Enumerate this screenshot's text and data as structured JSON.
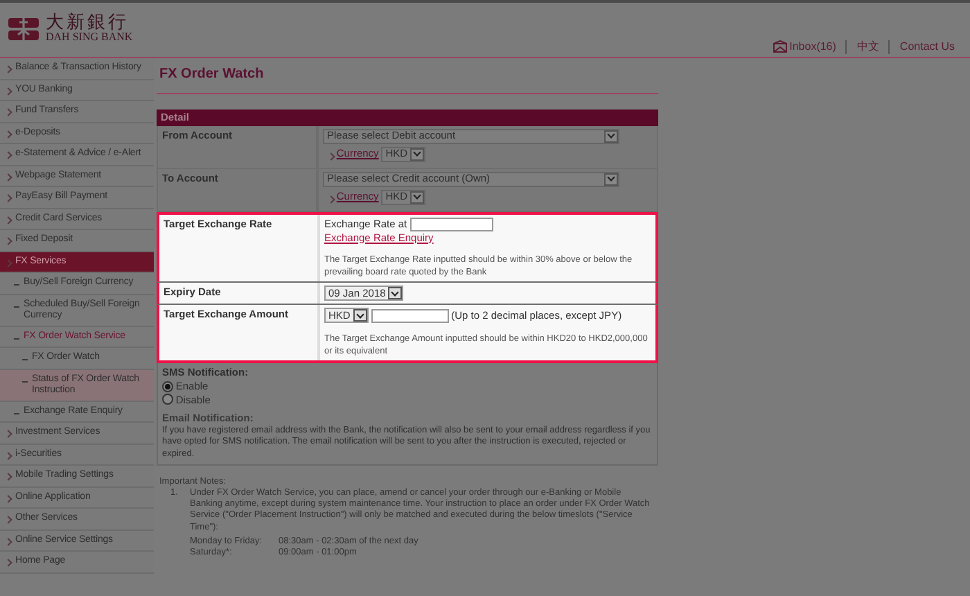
{
  "header": {
    "logo_text": "大新銀行",
    "logo_subtext": "DAH SING BANK",
    "links": [
      {
        "text": "Inbox(16)"
      },
      {
        "text": "中文"
      },
      {
        "text": "Contact Us"
      }
    ]
  },
  "sidebar": {
    "items": [
      {
        "label": "Balance & Transaction History",
        "selected": false,
        "hovered": false
      },
      {
        "label": "YOU Banking",
        "selected": false,
        "hovered": false
      },
      {
        "label": "Fund Transfers",
        "selected": false,
        "hovered": false
      },
      {
        "label": "e-Deposits",
        "selected": false,
        "hovered": false
      },
      {
        "label": "e-Statement & Advice / e-Alert",
        "selected": false,
        "hovered": false
      },
      {
        "label": "Webpage Statement",
        "selected": false,
        "hovered": false
      },
      {
        "label": "PayEasy Bill Payment",
        "selected": false,
        "hovered": false
      },
      {
        "label": "Credit Card Services",
        "selected": false,
        "hovered": false
      },
      {
        "label": "Fixed Deposit",
        "selected": false,
        "hovered": false
      },
      {
        "label": "FX Services",
        "selected": true,
        "hovered": false,
        "children": [
          {
            "label": "Buy/Sell Foreign Currency",
            "selected": false,
            "hovered": false
          },
          {
            "label": "Scheduled Buy/Sell Foreign Currency",
            "selected": false,
            "hovered": false
          },
          {
            "label": "FX Order Watch Service",
            "selected": true,
            "hovered": false,
            "children": [
              {
                "label": "FX Order Watch",
                "selected": false,
                "hovered": false
              },
              {
                "label": "Status of FX Order Watch Instruction",
                "selected": false,
                "hovered": true
              }
            ]
          },
          {
            "label": "Exchange Rate Enquiry",
            "selected": false,
            "hovered": false
          }
        ]
      },
      {
        "label": "Investment Services",
        "selected": false,
        "hovered": false
      },
      {
        "label": "i-Securities",
        "selected": false,
        "hovered": false
      },
      {
        "label": "Mobile Trading Settings",
        "selected": false,
        "hovered": false
      },
      {
        "label": "Online Application",
        "selected": false,
        "hovered": false
      },
      {
        "label": "Other Services",
        "selected": false,
        "hovered": false
      },
      {
        "label": "Online Service Settings",
        "selected": false,
        "hovered": false
      },
      {
        "label": "Home Page",
        "selected": false,
        "hovered": false
      }
    ]
  },
  "page_title": "FX Order Watch",
  "form": {
    "title": "Detail",
    "rows": [
      {
        "kind": "account",
        "label": "From Account",
        "highlighted": false,
        "select": "Please select Debit account",
        "link": "Currency",
        "currency": "HKD"
      },
      {
        "kind": "account",
        "label": "To Account",
        "highlighted": false,
        "select": "Please select Credit account (Own)",
        "link": "Currency",
        "currency": "HKD"
      },
      {
        "kind": "rate",
        "label": "Target Exchange Rate",
        "highlighted": true,
        "prefix": "Exchange Rate at",
        "link": "Exchange Rate Enquiry",
        "note": "The Target Exchange Rate inputted should be within 30% above or below the prevailing board rate quoted by the Bank"
      },
      {
        "kind": "date",
        "label": "Expiry Date",
        "highlighted": true,
        "select": "09 Jan 2018"
      },
      {
        "kind": "amount",
        "label": "Target Exchange Amount",
        "highlighted": true,
        "currency": "HKD",
        "hint": "(Up to 2 decimal places, except JPY)",
        "note": "The Target Exchange Amount inputted should be within HKD20 to HKD2,000,000 or its equivalent"
      }
    ],
    "sms": {
      "label": "SMS Notification:",
      "options": [
        {
          "label": "Enable",
          "selected": true
        },
        {
          "label": "Disable",
          "selected": false
        }
      ]
    },
    "email": {
      "title": "Email Notification:",
      "text": "If you have registered email address with the Bank, the notification will also be sent to your email address regardless if you have opted for SMS notification. The email notification will be sent to you after the instruction is executed, rejected or expired."
    }
  },
  "notes": {
    "title": "Important Notes:",
    "items": [
      {
        "number": "1.",
        "text": "Under FX Order Watch Service, you can place, amend or cancel your order through our e-Banking or Mobile Banking anytime, except during system maintenance time. Your instruction to place an order under FX Order Watch Service (\"Order Placement Instruction\") will only be matched and executed during the below timeslots (\"Service Time\"):",
        "schedule": [
          {
            "day": "Monday to Friday:",
            "time": "08:30am - 02:30am of the next day"
          },
          {
            "day": "Saturday*:",
            "time": "09:00am - 01:00pm"
          }
        ]
      }
    ]
  }
}
